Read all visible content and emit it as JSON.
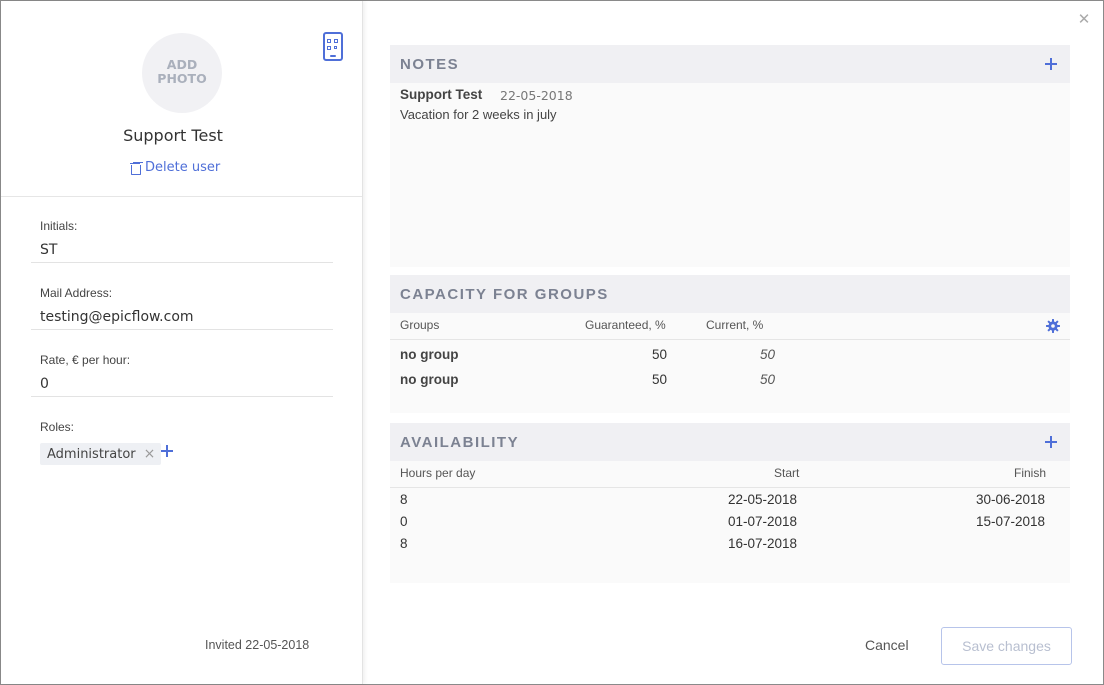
{
  "profile": {
    "avatar_label": "ADD PHOTO",
    "name": "Support Test",
    "delete_label": "Delete user",
    "qr_icon": "mobile-qr-icon"
  },
  "fields": {
    "initials_label": "Initials:",
    "initials_value": "ST",
    "mail_label": "Mail Address:",
    "mail_value": "testing@epicflow.com",
    "rate_label": "Rate, € per hour:",
    "rate_value": "0",
    "roles_label": "Roles:",
    "roles": [
      "Administrator"
    ]
  },
  "invited_text": "Invited 22-05-2018",
  "notes": {
    "title": "NOTES",
    "items": [
      {
        "author": "Support Test",
        "date": "22-05-2018",
        "text": "Vacation for 2 weeks in july"
      }
    ]
  },
  "capacity": {
    "title": "CAPACITY FOR GROUPS",
    "columns": [
      "Groups",
      "Guaranteed, %",
      "Current, %"
    ],
    "rows": [
      {
        "group": "no group",
        "guaranteed": "50",
        "current": "50"
      },
      {
        "group": "no group",
        "guaranteed": "50",
        "current": "50"
      }
    ]
  },
  "availability": {
    "title": "AVAILABILITY",
    "columns": [
      "Hours per day",
      "Start",
      "Finish"
    ],
    "rows": [
      {
        "hours": "8",
        "start": "22-05-2018",
        "finish": "30-06-2018"
      },
      {
        "hours": "0",
        "start": "01-07-2018",
        "finish": "15-07-2018"
      },
      {
        "hours": "8",
        "start": "16-07-2018",
        "finish": ""
      }
    ]
  },
  "actions": {
    "cancel": "Cancel",
    "save": "Save changes"
  },
  "colors": {
    "accent": "#4f6fd8",
    "section_header": "#f0f0f3"
  }
}
